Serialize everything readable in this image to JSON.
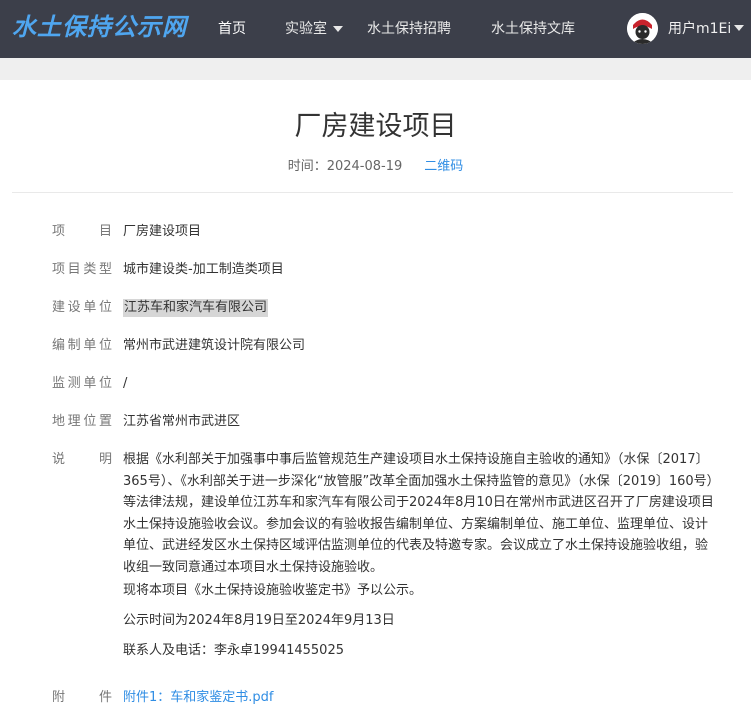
{
  "header": {
    "logo": "水土保持公示网",
    "nav": [
      "首页",
      "实验室",
      "水土保持招聘",
      "水土保持文库"
    ],
    "user": "用户m1Ei"
  },
  "article": {
    "title": "厂房建设项目",
    "time_label": "时间：",
    "time_value": "2024-08-19",
    "qr_label": "二维码",
    "fields": [
      {
        "label": "项目",
        "value": "厂房建设项目"
      },
      {
        "label": "项目类型",
        "value": "城市建设类-加工制造类项目"
      },
      {
        "label": "建设单位",
        "value": "江苏车和家汽车有限公司"
      },
      {
        "label": "编制单位",
        "value": "常州市武进建筑设计院有限公司"
      },
      {
        "label": "监测单位",
        "value": "/"
      },
      {
        "label": "地理位置",
        "value": "江苏省常州市武进区"
      }
    ],
    "desc_label": "说明",
    "desc_paragraphs": [
      "根据《水利部关于加强事中事后监管规范生产建设项目水土保持设施自主验收的通知》（水保〔2017〕365号）、《水利部关于进一步深化“放管服”改革全面加强水土保持监管的意见》（水保〔2019〕160号）等法律法规，建设单位江苏车和家汽车有限公司于2024年8月10日在常州市武进区召开了厂房建设项目水土保持设施验收会议。参加会议的有验收报告编制单位、方案编制单位、施工单位、监理单位、设计单位、武进经发区水土保持区域评估监测单位的代表及特邀专家。会议成立了水土保持设施验收组，验收组一致同意通过本项目水土保持设施验收。",
      "现将本项目《水土保持设施验收鉴定书》予以公示。",
      "公示时间为2024年8月19日至2024年9月13日",
      "联系人及电话：李永卓19941455025"
    ],
    "attach_label": "附件",
    "attachment": "附件1：车和家鉴定书.pdf"
  }
}
